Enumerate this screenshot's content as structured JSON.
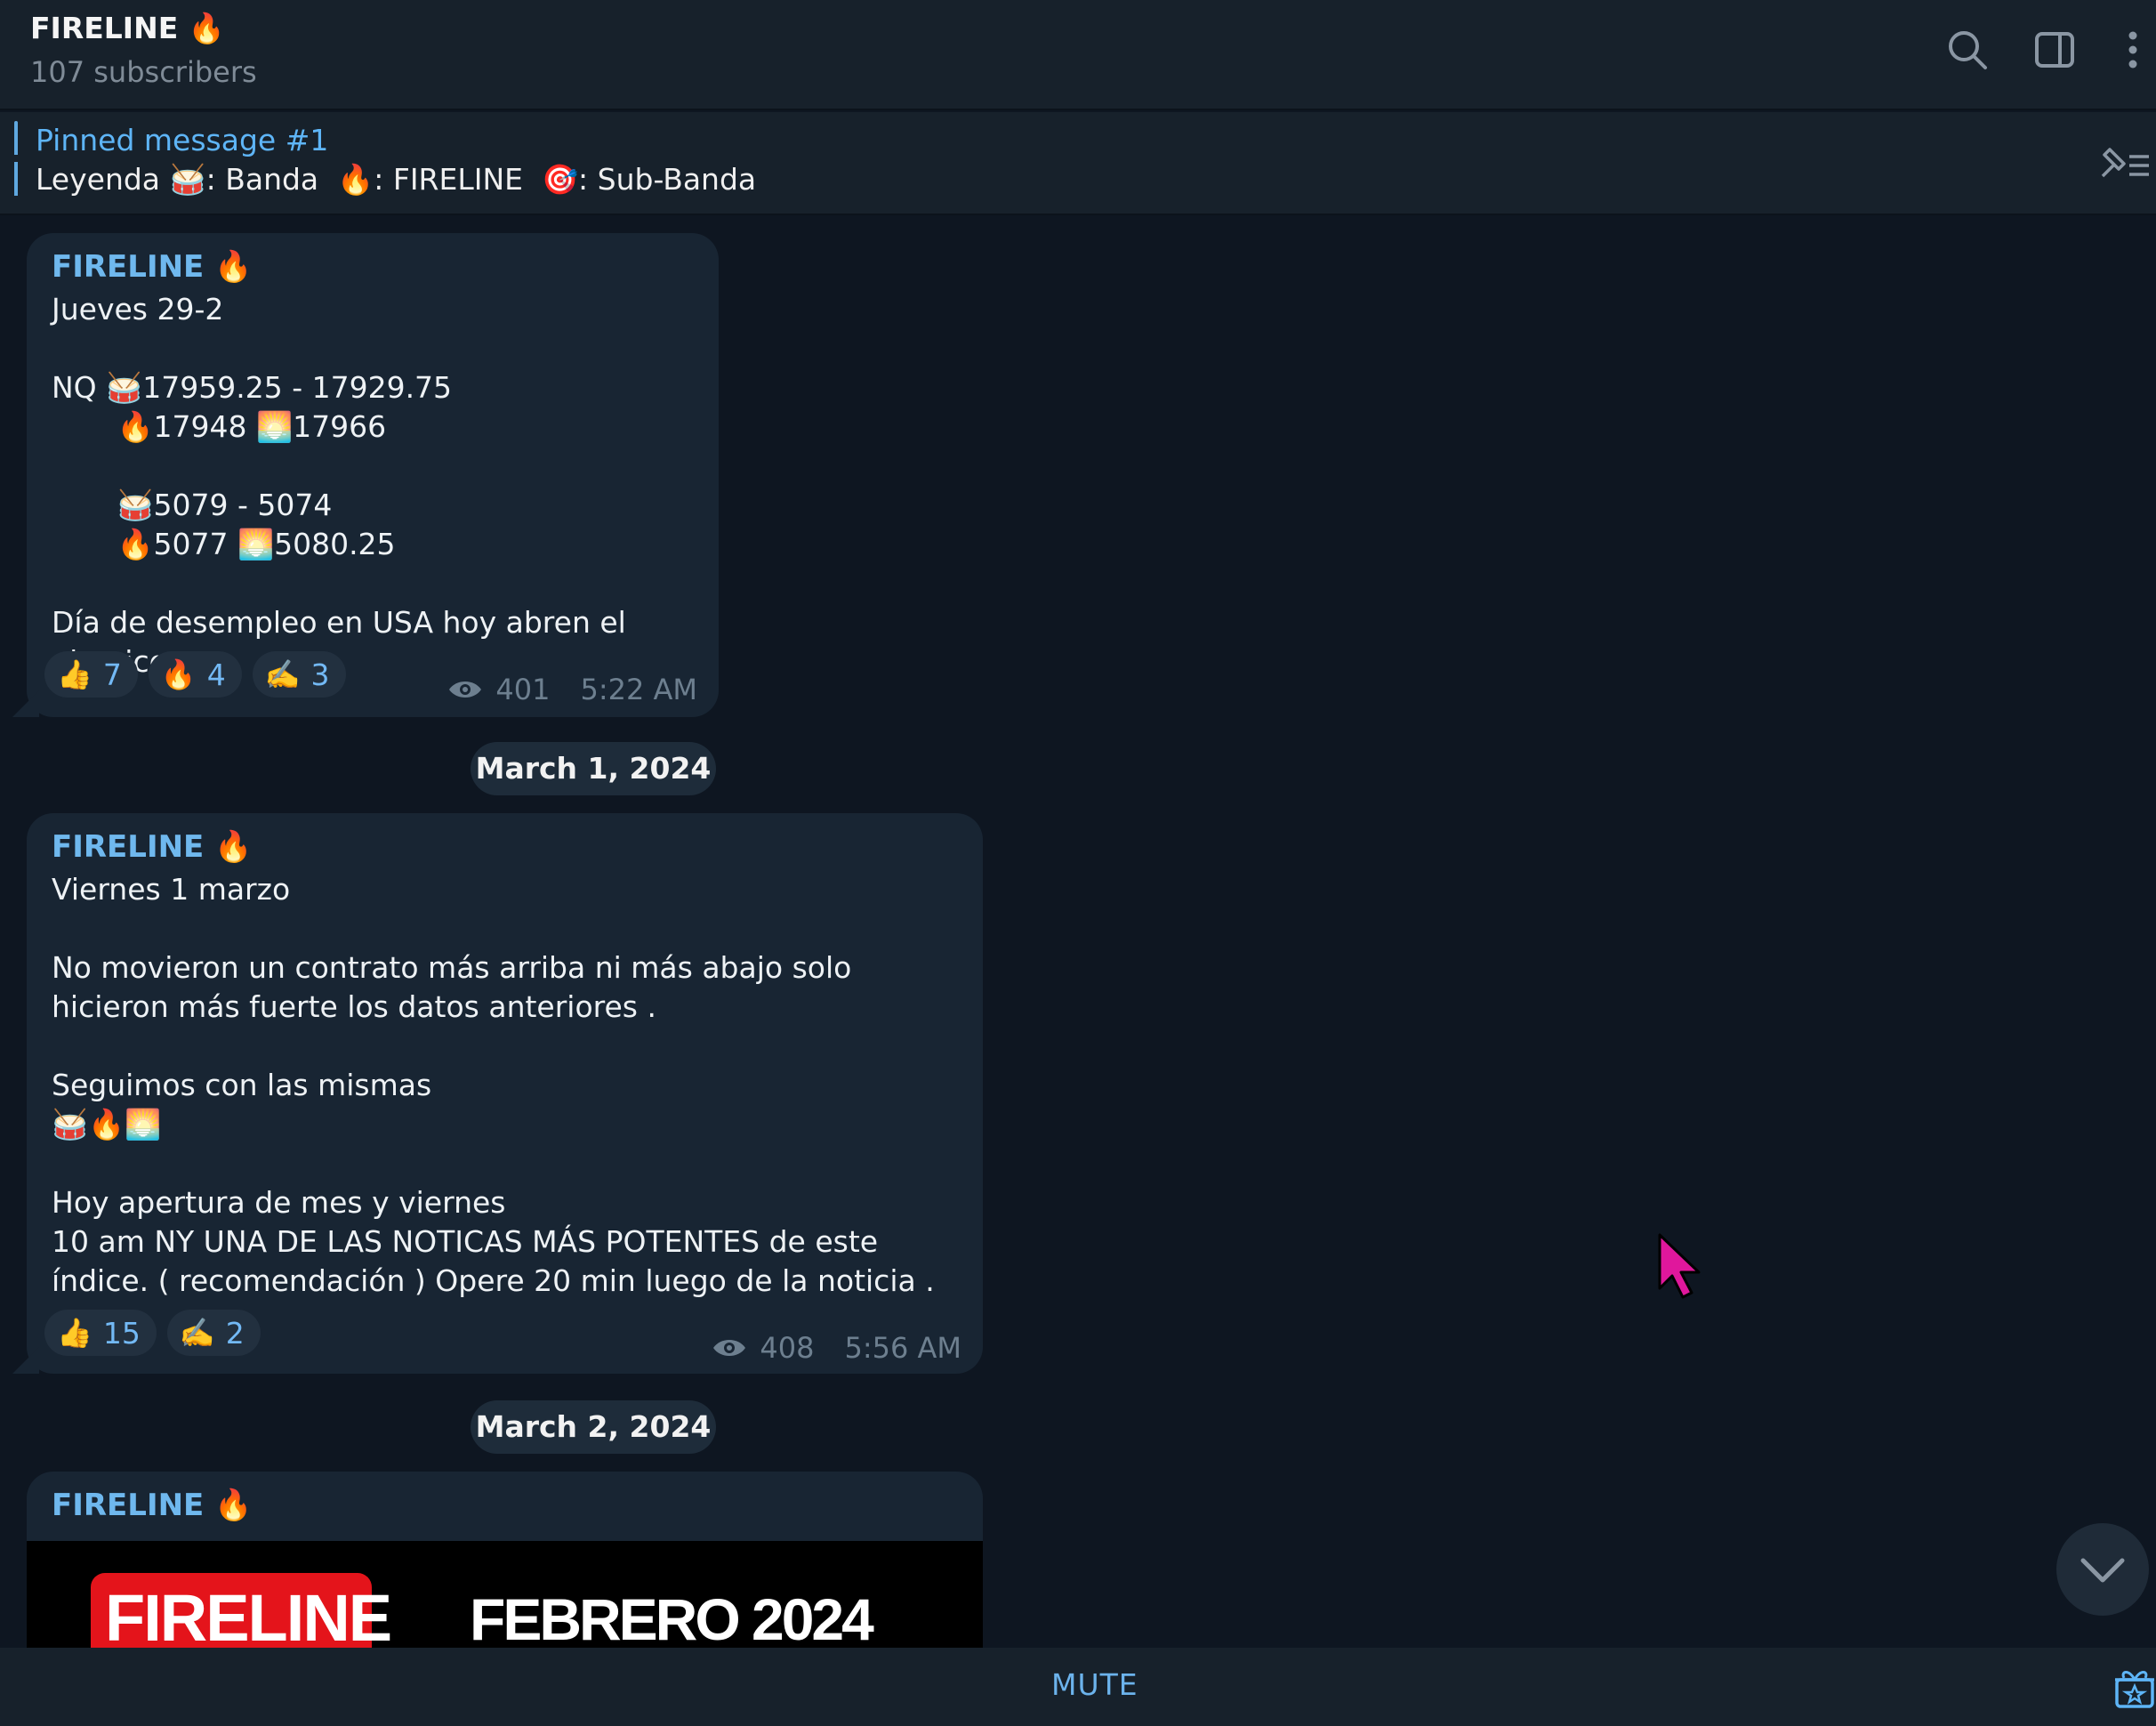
{
  "header": {
    "title": "FIRELINE 🔥",
    "subscribers": "107 subscribers",
    "icons": [
      "search-icon",
      "sidebar-toggle-icon",
      "more-vertical-icon"
    ]
  },
  "pinned": {
    "title": "Pinned message #1",
    "text": "Leyenda 🥁: Banda  🔥: FIRELINE  🎯: Sub-Banda"
  },
  "messages": [
    {
      "sender": "FIRELINE 🔥",
      "text": "Jueves 29-2\n\nNQ 🥁17959.25 - 17929.75\n       🔥17948 🌅17966\n\n       🥁5079 - 5074\n       🔥5077 🌅5080.25\n\nDía de desempleo en USA hoy abren el abanico .",
      "reactions": [
        {
          "emoji": "👍",
          "count": "7"
        },
        {
          "emoji": "🔥",
          "count": "4"
        },
        {
          "emoji": "✍️",
          "count": "3"
        }
      ],
      "views": "401",
      "time": "5:22 AM"
    },
    {
      "sender": "FIRELINE 🔥",
      "text": "Viernes 1 marzo\n\nNo movieron un contrato más arriba ni más abajo solo hicieron más fuerte los datos anteriores .\n\nSeguimos con las mismas\n🥁🔥🌅\n\nHoy apertura de mes y viernes\n10 am NY UNA DE LAS NOTICAS MÁS POTENTES de este índice. ( recomendación ) Opere 20 min luego de la noticia .",
      "reactions": [
        {
          "emoji": "👍",
          "count": "15"
        },
        {
          "emoji": "✍️",
          "count": "2"
        }
      ],
      "views": "408",
      "time": "5:56 AM"
    },
    {
      "sender": "FIRELINE 🔥",
      "media_logo": "FIRELINE",
      "media_title": "FEBRERO 2024"
    }
  ],
  "dates": [
    "March 1, 2024",
    "March 2, 2024"
  ],
  "bottom": {
    "mute_label": "MUTE"
  },
  "colors": {
    "background": "#0e1621",
    "panel": "#17212b",
    "bubble": "#182533",
    "accent": "#5eb5f7",
    "cursor": "#e0179c"
  }
}
